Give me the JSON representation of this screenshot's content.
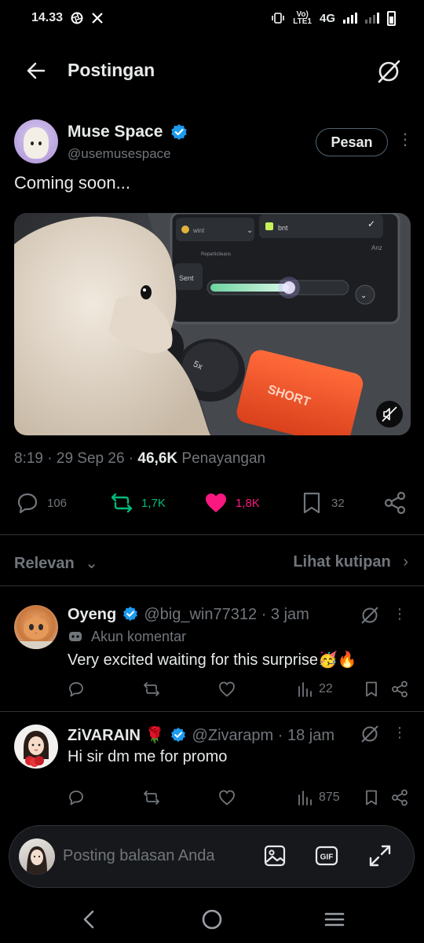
{
  "status_bar": {
    "time": "14.33",
    "network_label_top": "Vo)",
    "network_label_bottom": "LTE1",
    "network_type": "4G"
  },
  "app_bar": {
    "title": "Postingan"
  },
  "tweet": {
    "author_name": "Muse Space",
    "author_handle": "@usemusespace",
    "follow_button": "Pesan",
    "text": "Coming soon...",
    "video_ui": {
      "dropdown_left": "wint",
      "dropdown_right": "bnt",
      "label_top": "Reparticlieans",
      "label_right": "Anz",
      "slider_label": "Sent",
      "knob_label": "5x",
      "button_label": "SHORT"
    },
    "time": "8:19",
    "date": "29 Sep 26",
    "views_count": "46,6K",
    "views_label": "Penayangan",
    "replies": "106",
    "reposts": "1,7K",
    "likes": "1,8K",
    "bookmarks": "32"
  },
  "filters": {
    "sort_label": "Relevan",
    "quotes_label": "Lihat kutipan"
  },
  "replies": [
    {
      "name": "Oyeng",
      "handle": "@big_win77312",
      "time": "· 3 jam",
      "sub_label": "Akun komentar",
      "text": "Very excited waiting for this surprise🥳🔥",
      "views": "22"
    },
    {
      "name": "ZiVARAIN 🌹",
      "handle": "@Zivarapm",
      "time": "· 18 jam",
      "text": "Hi sir dm me for promo",
      "views": "875"
    }
  ],
  "composer": {
    "placeholder": "Posting balasan Anda",
    "gif_label": "GIF"
  },
  "colors": {
    "background": "#000000",
    "text": "#e7e9ea",
    "muted": "#71767b",
    "verified": "#1d9bf0",
    "repost": "#00ba7c",
    "like": "#f91880",
    "border": "#2f3336"
  }
}
